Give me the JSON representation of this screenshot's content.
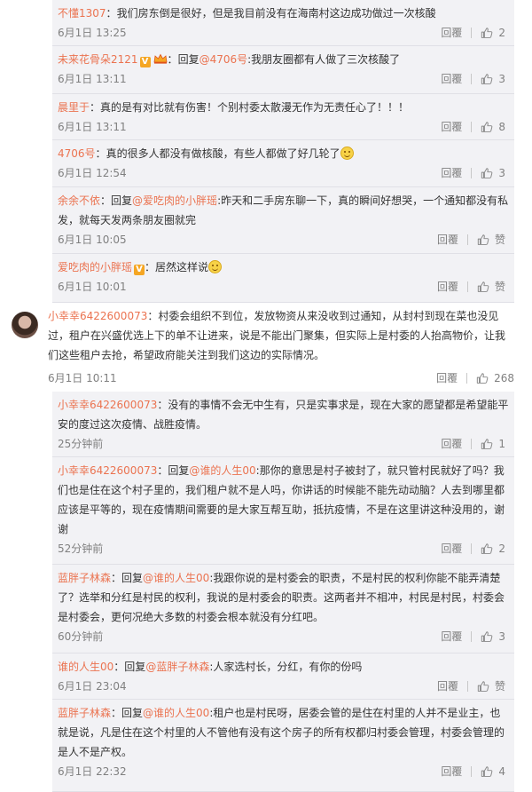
{
  "top_replies": [
    {
      "user": "不懂1307",
      "badge": "",
      "segments": [
        {
          "text": "我们房东倒是很好，但是我目前没有在海南村这边成功做过一次核酸"
        }
      ],
      "time": "6月1日 13:25",
      "reply": "回覆",
      "likes": "2"
    },
    {
      "user": "未来花骨朵2121",
      "badge": "vcrown",
      "segments": [
        {
          "text": "回复"
        },
        {
          "at": "@4706号"
        },
        {
          "text": ":我朋友圈都有人做了三次核酸了"
        }
      ],
      "time": "6月1日 13:11",
      "reply": "回覆",
      "likes": "3"
    },
    {
      "user": "晨里于",
      "badge": "",
      "segments": [
        {
          "text": "真的是有对比就有伤害！个别村委太散漫无作为无责任心了！！！"
        }
      ],
      "time": "6月1日 13:11",
      "reply": "回覆",
      "likes": "8"
    },
    {
      "user": "4706号",
      "badge": "",
      "segments": [
        {
          "text": "真的很多人都没有做核酸，有些人都做了好几轮了"
        },
        {
          "emoji": "smile"
        }
      ],
      "time": "6月1日 12:54",
      "reply": "回覆",
      "likes": "3"
    },
    {
      "user": "余余不依",
      "badge": "",
      "segments": [
        {
          "text": "回复"
        },
        {
          "at": "@爱吃肉的小胖瑶"
        },
        {
          "text": ":昨天和二手房东聊一下，真的瞬间好想哭，一个通知都没有私发，就每天发两条朋友圈就完"
        }
      ],
      "time": "6月1日 10:05",
      "reply": "回覆",
      "likes": "赞"
    },
    {
      "user": "爱吃肉的小胖瑶",
      "badge": "v",
      "segments": [
        {
          "text": "居然这样说"
        },
        {
          "emoji": "smile"
        }
      ],
      "time": "6月1日 10:01",
      "reply": "回覆",
      "likes": "赞"
    }
  ],
  "main_comment": {
    "user": "小幸幸6422600073",
    "text": "村委会组织不到位，发放物资从来没收到过通知，从封村到现在菜也没见过，租户在兴盛优选上下的单不让进来，说是不能出门聚集，但实际上是村委的人抬高物价，让我们这些租户去抢，希望政府能关注到我们这边的实际情况。",
    "time": "6月1日 10:11",
    "reply": "回覆",
    "likes": "268"
  },
  "bottom_replies": [
    {
      "user": "小幸幸6422600073",
      "badge": "",
      "segments": [
        {
          "text": "没有的事情不会无中生有，只是实事求是，现在大家的愿望都是希望能平安的度过这次疫情、战胜疫情。"
        }
      ],
      "time": "25分钟前",
      "reply": "回覆",
      "likes": "1"
    },
    {
      "user": "小幸幸6422600073",
      "badge": "",
      "segments": [
        {
          "text": "回复"
        },
        {
          "at": "@谁的人生00"
        },
        {
          "text": ":那你的意思是村子被封了，就只管村民就好了吗？我们也是住在这个村子里的，我们租户就不是人吗，你讲话的时候能不能先动动脑？人去到哪里都应该是平等的，现在疫情期间需要的是大家互帮互助，抵抗疫情，不是在这里讲这种没用的，谢谢"
        }
      ],
      "time": "52分钟前",
      "reply": "回覆",
      "likes": "2"
    },
    {
      "user": "蓝胖子林森",
      "badge": "",
      "segments": [
        {
          "text": "回复"
        },
        {
          "at": "@谁的人生00"
        },
        {
          "text": ":我跟你说的是村委会的职责，不是村民的权利你能不能弄清楚了？选举和分红是村民的权利，我说的是村委会的职责。这两者并不相冲，村民是村民，村委会是村委会，更何况绝大多数的村委会根本就没有分红吧。"
        }
      ],
      "time": "60分钟前",
      "reply": "回覆",
      "likes": "3"
    },
    {
      "user": "谁的人生00",
      "badge": "",
      "segments": [
        {
          "text": "回复"
        },
        {
          "at": "@蓝胖子林森"
        },
        {
          "text": ":人家选村长，分红，有你的份吗"
        }
      ],
      "time": "6月1日 23:04",
      "reply": "回覆",
      "likes": "赞"
    },
    {
      "user": "蓝胖子林森",
      "badge": "",
      "segments": [
        {
          "text": "回复"
        },
        {
          "at": "@谁的人生00"
        },
        {
          "text": ":租户也是村民呀，居委会管的是住在村里的人并不是业主，也就是说，凡是住在这个村里的人不管他有没有这个房子的所有权都归村委会管理，村委会管理的是人不是产权。"
        }
      ],
      "time": "6月1日 22:32",
      "reply": "回覆",
      "likes": "4"
    }
  ]
}
